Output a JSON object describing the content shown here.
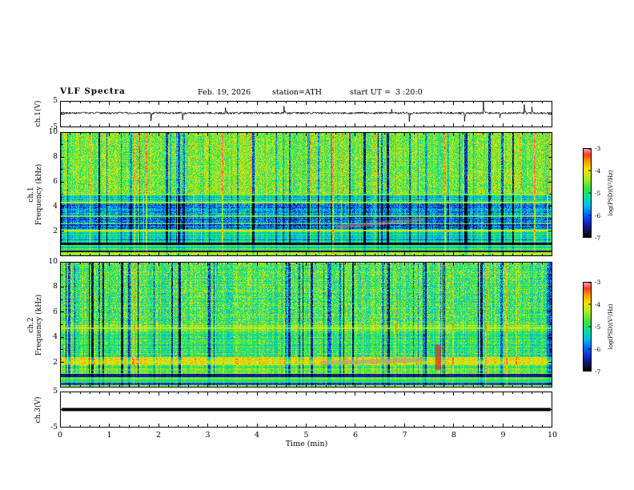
{
  "header": {
    "title": "VLF Spectra",
    "date": "Feb. 19, 2026",
    "station": "station=ATH",
    "start_ut": "start UT =  3 :20:0"
  },
  "x_axis": {
    "label": "Time (min)",
    "min": 0,
    "max": 10,
    "ticks": [
      0,
      1,
      2,
      3,
      4,
      5,
      6,
      7,
      8,
      9,
      10
    ]
  },
  "colormap": {
    "stops": [
      [
        0,
        0,
        0,
        0
      ],
      [
        0.06,
        15,
        15,
        60
      ],
      [
        0.16,
        25,
        35,
        190
      ],
      [
        0.26,
        0,
        100,
        255
      ],
      [
        0.36,
        0,
        190,
        235
      ],
      [
        0.46,
        0,
        225,
        150
      ],
      [
        0.56,
        70,
        225,
        60
      ],
      [
        0.67,
        175,
        235,
        40
      ],
      [
        0.77,
        245,
        225,
        0
      ],
      [
        0.86,
        255,
        150,
        0
      ],
      [
        0.93,
        255,
        60,
        40
      ],
      [
        1,
        255,
        165,
        175
      ]
    ]
  },
  "colorbars": [
    {
      "label": "log(PSD)(V²/Hz)",
      "min": -7,
      "max": -3,
      "ticks": [
        -3,
        -4,
        -5,
        -6,
        -7
      ]
    },
    {
      "label": "log(PSD)(V²/Hz)",
      "min": -7,
      "max": -3,
      "ticks": [
        -3,
        -4,
        -5,
        -6,
        -7
      ]
    }
  ],
  "chart_data": [
    {
      "type": "line",
      "panel": "ch1-waveform",
      "ylabel": "ch.1(V)",
      "ylim": [
        -5,
        5
      ],
      "yticks": [
        5,
        -5
      ],
      "series": [
        {
          "name": "ch.1",
          "color": "#000000",
          "baseline": 0.4,
          "noise_amp": 0.4,
          "spike_rate": 0.015,
          "spike_amp": 3.2,
          "line_width": 0.8
        }
      ]
    },
    {
      "type": "heatmap",
      "panel": "ch1-spectrogram",
      "ylabel_lines": [
        "ch.1",
        "Frequency (kHz)"
      ],
      "ylim": [
        0,
        10
      ],
      "yticks": [
        10,
        8,
        6,
        4,
        2
      ],
      "value_range": [
        -7,
        -3
      ],
      "bands": [
        {
          "f": [
            5,
            10
          ],
          "base": -4.55,
          "noise": 0.5,
          "row_coh": 0.15
        },
        {
          "f": [
            4.3,
            5
          ],
          "base": -5.2,
          "noise": 0.55,
          "row_coh": 0.45
        },
        {
          "f": [
            2.2,
            4.3
          ],
          "base": -5.9,
          "noise": 0.65,
          "row_coh": 0.45
        },
        {
          "f": [
            1.9,
            2.2
          ],
          "base": -4.9,
          "noise": 0.45,
          "row_coh": 0.5
        },
        {
          "f": [
            1.1,
            1.9
          ],
          "base": -5.4,
          "noise": 0.55,
          "row_coh": 0.6
        },
        {
          "f": [
            0.85,
            1.1
          ],
          "base": -6.8,
          "noise": 0.15,
          "row_coh": 0.3
        },
        {
          "f": [
            0.45,
            0.85
          ],
          "base": -5.0,
          "noise": 0.5,
          "row_coh": 0.8
        },
        {
          "f": [
            0.28,
            0.45
          ],
          "base": -6.6,
          "noise": 0.25,
          "row_coh": 0.5
        },
        {
          "f": [
            0,
            0.28
          ],
          "base": -4.2,
          "noise": 0.35,
          "row_coh": 0.6
        }
      ],
      "hlines": [
        {
          "f": 2.05,
          "amp": 0.8
        },
        {
          "f": 2.6,
          "amp": 0.55
        },
        {
          "f": 3.2,
          "amp": 0.45
        },
        {
          "f": 4.3,
          "amp": 0.7
        },
        {
          "f": 4.95,
          "amp": 0.5
        }
      ],
      "stripes": {
        "dark_prob": 0.1,
        "dark_amp": [
          0.7,
          2.0
        ],
        "bright_prob": 0.05,
        "bright_amp": [
          0.6,
          1.5
        ]
      },
      "patches": [
        {
          "kind": "band",
          "x": [
            5.6,
            7.4
          ],
          "f": [
            2.35,
            2.95
          ],
          "thickness_khz": 0.3,
          "color": "#b58a7a",
          "alpha": 0.5
        }
      ]
    },
    {
      "type": "heatmap",
      "panel": "ch2-spectrogram",
      "ylabel_lines": [
        "ch.2",
        "Frequency (kHz)"
      ],
      "ylim": [
        0,
        10
      ],
      "yticks": [
        10,
        8,
        6,
        4,
        2
      ],
      "value_range": [
        -7,
        -3
      ],
      "bands": [
        {
          "f": [
            5,
            10
          ],
          "base": -4.8,
          "noise": 0.6,
          "row_coh": 0.2
        },
        {
          "f": [
            4.5,
            5
          ],
          "base": -4.55,
          "noise": 0.4,
          "row_coh": 0.55
        },
        {
          "f": [
            2.4,
            4.5
          ],
          "base": -4.95,
          "noise": 0.55,
          "row_coh": 0.35
        },
        {
          "f": [
            1.75,
            2.4
          ],
          "base": -4.1,
          "noise": 0.4,
          "row_coh": 0.55
        },
        {
          "f": [
            1.05,
            1.75
          ],
          "base": -4.8,
          "noise": 0.5,
          "row_coh": 0.6
        },
        {
          "f": [
            0.8,
            1.05
          ],
          "base": -6.5,
          "noise": 0.2,
          "row_coh": 0.4
        },
        {
          "f": [
            0.35,
            0.8
          ],
          "base": -4.7,
          "noise": 0.5,
          "row_coh": 0.8
        },
        {
          "f": [
            0.18,
            0.35
          ],
          "base": -6.2,
          "noise": 0.3,
          "row_coh": 0.5
        },
        {
          "f": [
            0,
            0.18
          ],
          "base": -4.3,
          "noise": 0.3,
          "row_coh": 0.5
        }
      ],
      "hlines": [
        {
          "f": 1.95,
          "amp": 0.95
        },
        {
          "f": 2.1,
          "amp": 0.7
        },
        {
          "f": 1.35,
          "amp": 0.5
        },
        {
          "f": 4.7,
          "amp": 0.7
        }
      ],
      "stripes": {
        "dark_prob": 0.11,
        "dark_amp": [
          0.7,
          2.0
        ],
        "bright_prob": 0.03,
        "bright_amp": [
          0.4,
          1.0
        ]
      },
      "patches": [
        {
          "kind": "band",
          "x": [
            5.3,
            7.4
          ],
          "f": [
            1.95,
            2.2
          ],
          "thickness_khz": 0.35,
          "color": "#9a9a9a",
          "alpha": 0.55
        },
        {
          "kind": "rect",
          "x": [
            7.62,
            7.74
          ],
          "f": [
            1.4,
            3.4
          ],
          "color": "#cc2222",
          "alpha": 0.65
        }
      ]
    },
    {
      "type": "line",
      "panel": "ch3-flat",
      "ylabel": "ch.3(V)",
      "ylim": [
        -5,
        5
      ],
      "yticks": [
        5,
        -5
      ],
      "series": [
        {
          "name": "ch.3",
          "color": "#000000",
          "baseline": 0,
          "noise_amp": 0,
          "spike_rate": 0,
          "spike_amp": 0,
          "line_width": 4
        }
      ]
    }
  ]
}
